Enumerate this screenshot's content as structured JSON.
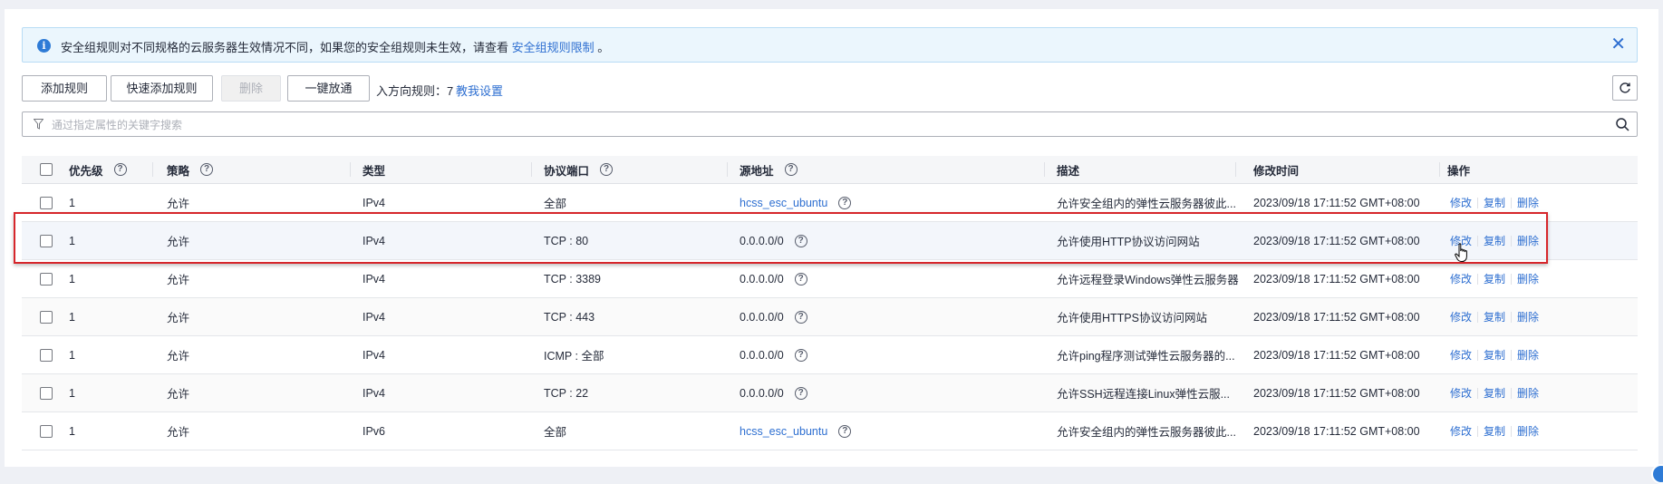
{
  "notice": {
    "text": "安全组规则对不同规格的云服务器生效情况不同，如果您的安全组规则未生效，请查看",
    "link": "安全组规则限制",
    "suffix": "。"
  },
  "toolbar": {
    "add_rule": "添加规则",
    "quick_add_rule": "快速添加规则",
    "delete": "删除",
    "one_click_open": "一键放通",
    "inbound_count": "入方向规则：7",
    "help_link": "教我设置"
  },
  "search": {
    "placeholder": "通过指定属性的关键字搜索"
  },
  "table": {
    "columns": {
      "priority": "优先级",
      "policy": "策略",
      "type": "类型",
      "protocol_port": "协议端口",
      "source": "源地址",
      "description": "描述",
      "modified": "修改时间",
      "actions": "操作"
    },
    "action_labels": {
      "edit": "修改",
      "copy": "复制",
      "delete": "删除"
    },
    "rows": [
      {
        "priority": "1",
        "policy": "允许",
        "type": "IPv4",
        "port": "全部",
        "source": "hcss_esc_ubuntu",
        "source_is_link": true,
        "description": "允许安全组内的弹性云服务器彼此...",
        "modified": "2023/09/18 17:11:52 GMT+08:00"
      },
      {
        "priority": "1",
        "policy": "允许",
        "type": "IPv4",
        "port": "TCP : 80",
        "source": "0.0.0.0/0",
        "source_is_link": false,
        "description": "允许使用HTTP协议访问网站",
        "modified": "2023/09/18 17:11:52 GMT+08:00"
      },
      {
        "priority": "1",
        "policy": "允许",
        "type": "IPv4",
        "port": "TCP : 3389",
        "source": "0.0.0.0/0",
        "source_is_link": false,
        "description": "允许远程登录Windows弹性云服务器",
        "modified": "2023/09/18 17:11:52 GMT+08:00"
      },
      {
        "priority": "1",
        "policy": "允许",
        "type": "IPv4",
        "port": "TCP : 443",
        "source": "0.0.0.0/0",
        "source_is_link": false,
        "description": "允许使用HTTPS协议访问网站",
        "modified": "2023/09/18 17:11:52 GMT+08:00"
      },
      {
        "priority": "1",
        "policy": "允许",
        "type": "IPv4",
        "port": "ICMP : 全部",
        "source": "0.0.0.0/0",
        "source_is_link": false,
        "description": "允许ping程序测试弹性云服务器的...",
        "modified": "2023/09/18 17:11:52 GMT+08:00"
      },
      {
        "priority": "1",
        "policy": "允许",
        "type": "IPv4",
        "port": "TCP : 22",
        "source": "0.0.0.0/0",
        "source_is_link": false,
        "description": "允许SSH远程连接Linux弹性云服...",
        "modified": "2023/09/18 17:11:52 GMT+08:00"
      },
      {
        "priority": "1",
        "policy": "允许",
        "type": "IPv6",
        "port": "全部",
        "source": "hcss_esc_ubuntu",
        "source_is_link": true,
        "description": "允许安全组内的弹性云服务器彼此...",
        "modified": "2023/09/18 17:11:52 GMT+08:00"
      }
    ]
  },
  "colors": {
    "accent": "#2e6fd1",
    "highlight_border": "#d6262b",
    "notice_bg": "#ebf6fd"
  }
}
